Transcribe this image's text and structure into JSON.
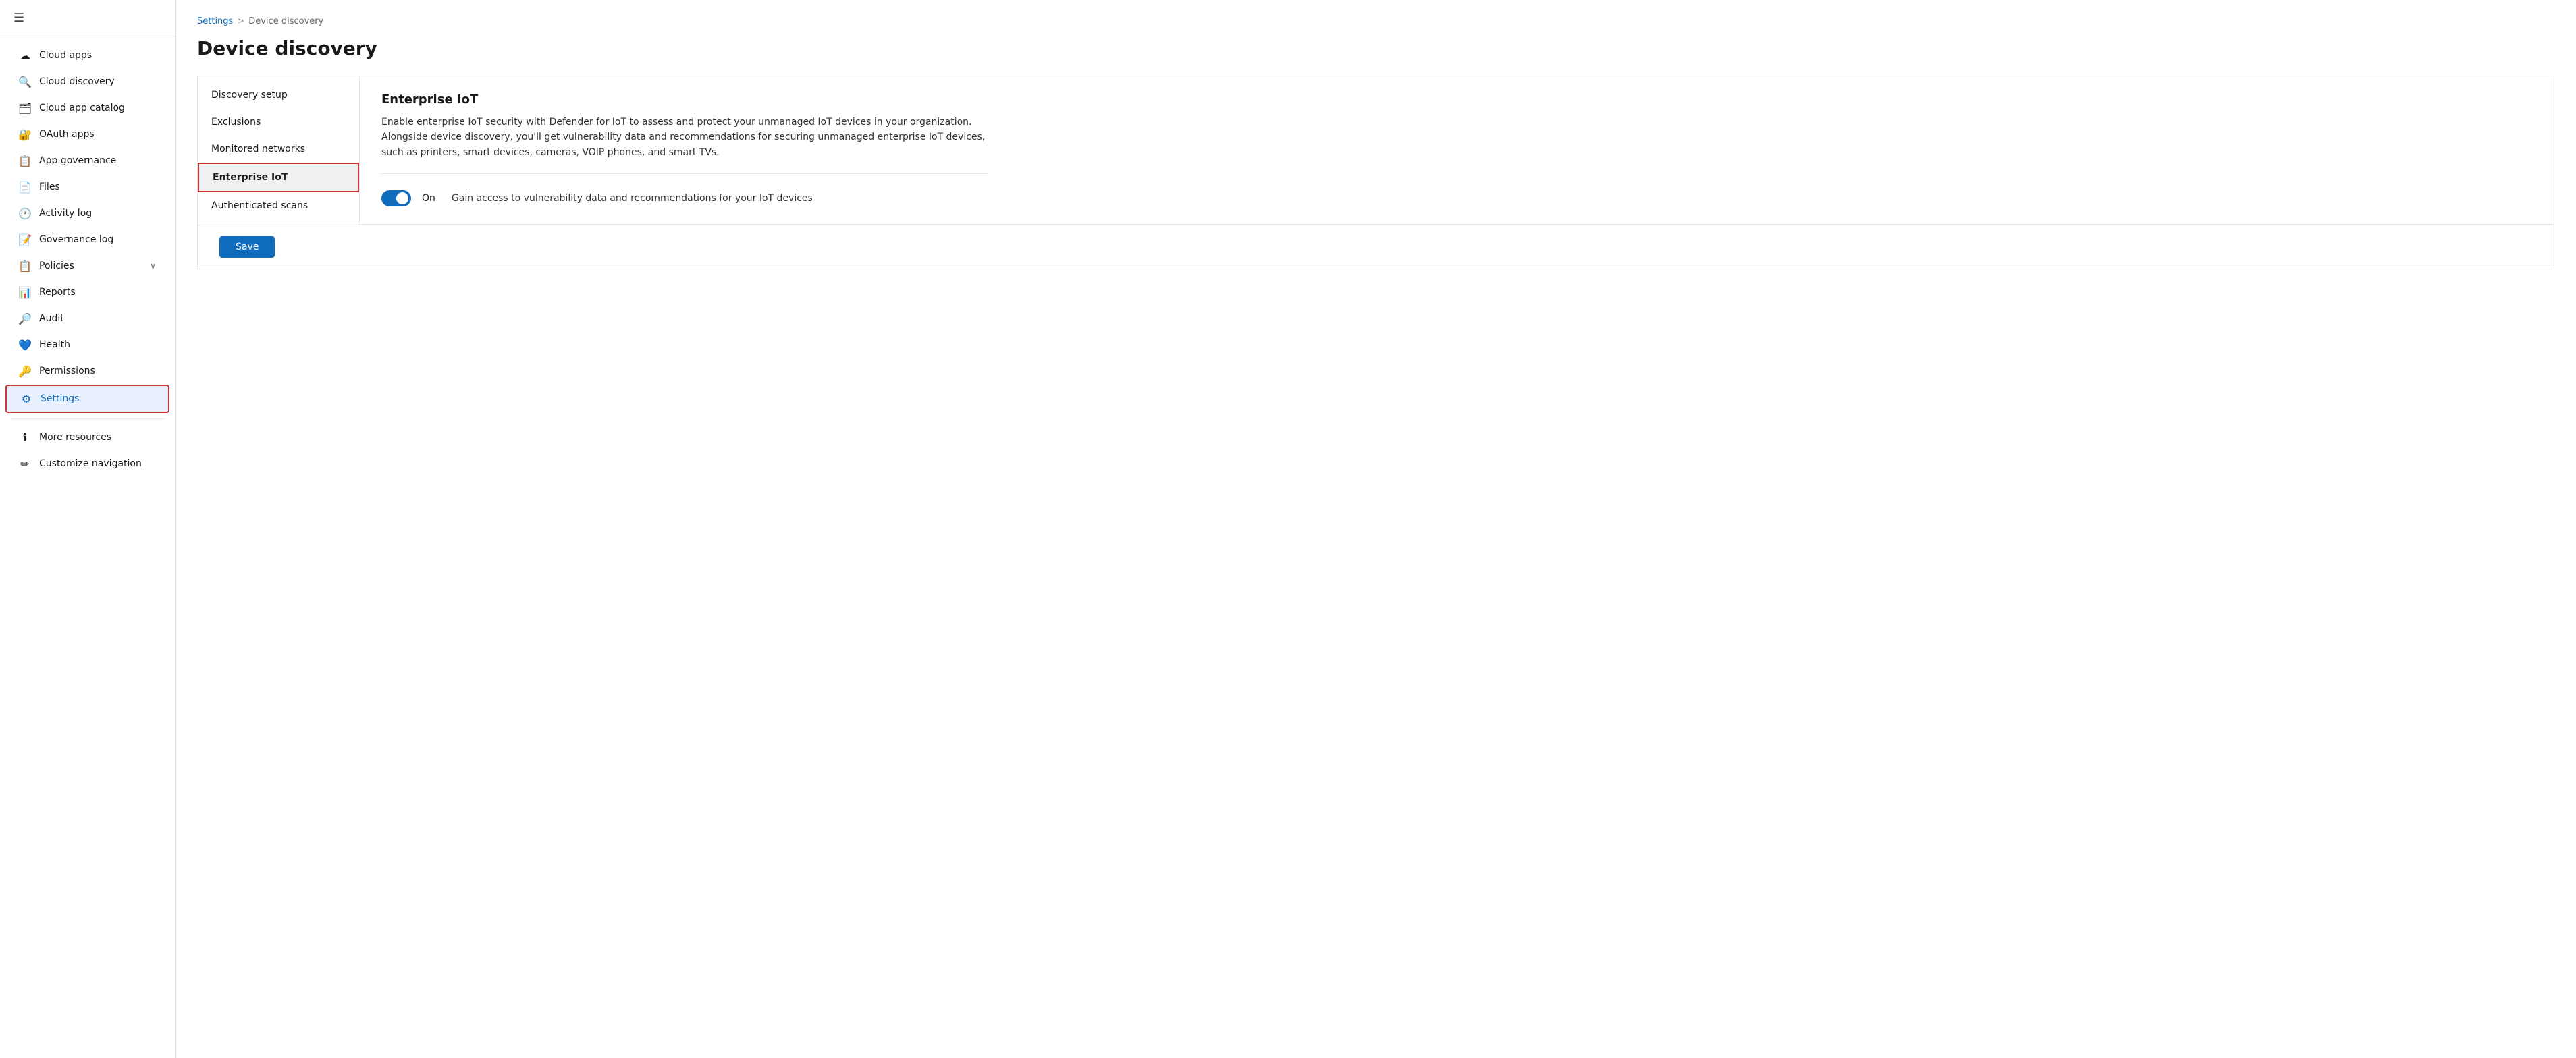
{
  "sidebar": {
    "hamburger": "☰",
    "items": [
      {
        "id": "cloud-apps",
        "label": "Cloud apps",
        "icon": "☁",
        "active": false
      },
      {
        "id": "cloud-discovery",
        "label": "Cloud discovery",
        "icon": "🔍",
        "active": false
      },
      {
        "id": "cloud-app-catalog",
        "label": "Cloud app catalog",
        "icon": "🗂",
        "active": false
      },
      {
        "id": "oauth-apps",
        "label": "OAuth apps",
        "icon": "🔐",
        "active": false
      },
      {
        "id": "app-governance",
        "label": "App governance",
        "icon": "📋",
        "active": false
      },
      {
        "id": "files",
        "label": "Files",
        "icon": "📄",
        "active": false
      },
      {
        "id": "activity-log",
        "label": "Activity log",
        "icon": "🕐",
        "active": false
      },
      {
        "id": "governance-log",
        "label": "Governance log",
        "icon": "📝",
        "active": false
      },
      {
        "id": "policies",
        "label": "Policies",
        "icon": "📋",
        "has_chevron": true,
        "active": false
      },
      {
        "id": "reports",
        "label": "Reports",
        "icon": "📊",
        "active": false
      },
      {
        "id": "audit",
        "label": "Audit",
        "icon": "🔎",
        "active": false
      },
      {
        "id": "health",
        "label": "Health",
        "icon": "💙",
        "active": false
      },
      {
        "id": "permissions",
        "label": "Permissions",
        "icon": "🔑",
        "active": false
      },
      {
        "id": "settings",
        "label": "Settings",
        "icon": "⚙",
        "active": true
      },
      {
        "id": "more-resources",
        "label": "More resources",
        "icon": "ℹ",
        "active": false
      },
      {
        "id": "customize-navigation",
        "label": "Customize navigation",
        "icon": "✏",
        "active": false
      }
    ]
  },
  "breadcrumb": {
    "settings": "Settings",
    "separator": ">",
    "current": "Device discovery"
  },
  "page": {
    "title": "Device discovery"
  },
  "sub_nav": {
    "items": [
      {
        "id": "discovery-setup",
        "label": "Discovery setup",
        "active": false
      },
      {
        "id": "exclusions",
        "label": "Exclusions",
        "active": false
      },
      {
        "id": "monitored-networks",
        "label": "Monitored networks",
        "active": false
      },
      {
        "id": "enterprise-iot",
        "label": "Enterprise IoT",
        "active": true
      },
      {
        "id": "authenticated-scans",
        "label": "Authenticated scans",
        "active": false
      }
    ]
  },
  "detail": {
    "title": "Enterprise IoT",
    "description": "Enable enterprise IoT security with Defender for IoT to assess and protect your unmanaged IoT devices in your organization. Alongside device discovery, you'll get vulnerability data and recommendations for securing unmanaged enterprise IoT devices, such as printers, smart devices, cameras, VOIP phones, and smart TVs.",
    "toggle": {
      "state": "On",
      "description": "Gain access to vulnerability data and recommendations for your IoT devices"
    }
  },
  "actions": {
    "save_label": "Save"
  }
}
